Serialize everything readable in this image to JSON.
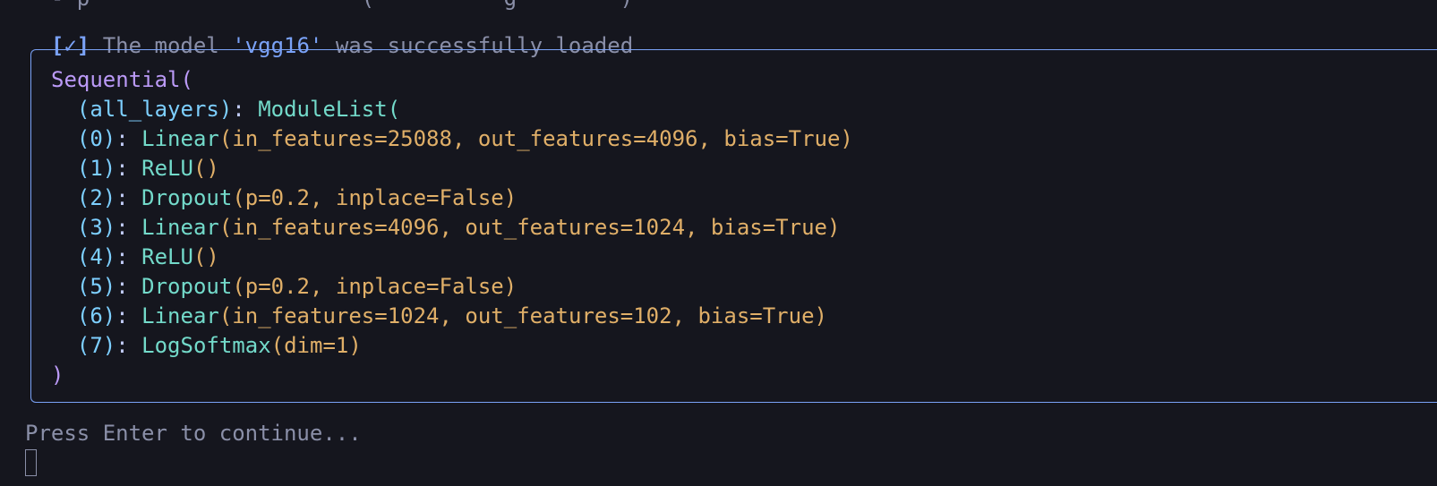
{
  "terminal": {
    "clipped_previous_line": "  - p                     (          g        )",
    "success": {
      "check": "[✓]",
      "prefix": " The model ",
      "model_name": "'vgg16'",
      "suffix": " was successfully loaded"
    },
    "model_repr": {
      "open": "Sequential(",
      "close": ")",
      "container_key": "  (all_layers)",
      "container_sep": ": ",
      "container_name": "ModuleList(",
      "layers": [
        {
          "index": "  (0)",
          "sep": ": ",
          "type": "Linear",
          "args": "(in_features=25088, out_features=4096, bias=True)"
        },
        {
          "index": "  (1)",
          "sep": ": ",
          "type": "ReLU",
          "args": "()"
        },
        {
          "index": "  (2)",
          "sep": ": ",
          "type": "Dropout",
          "args": "(p=0.2, inplace=False)"
        },
        {
          "index": "  (3)",
          "sep": ": ",
          "type": "Linear",
          "args": "(in_features=4096, out_features=1024, bias=True)"
        },
        {
          "index": "  (4)",
          "sep": ": ",
          "type": "ReLU",
          "args": "()"
        },
        {
          "index": "  (5)",
          "sep": ": ",
          "type": "Dropout",
          "args": "(p=0.2, inplace=False)"
        },
        {
          "index": "  (6)",
          "sep": ": ",
          "type": "Linear",
          "args": "(in_features=1024, out_features=102, bias=True)"
        },
        {
          "index": "  (7)",
          "sep": ": ",
          "type": "LogSoftmax",
          "args": "(dim=1)"
        }
      ]
    },
    "prompt": "Press Enter to continue..."
  },
  "colors": {
    "background": "#15161e",
    "accent_blue": "#7aa2f7",
    "purple": "#bb9af7",
    "teal": "#73daca",
    "orange": "#e0af68",
    "muted": "#8a8fa8"
  }
}
